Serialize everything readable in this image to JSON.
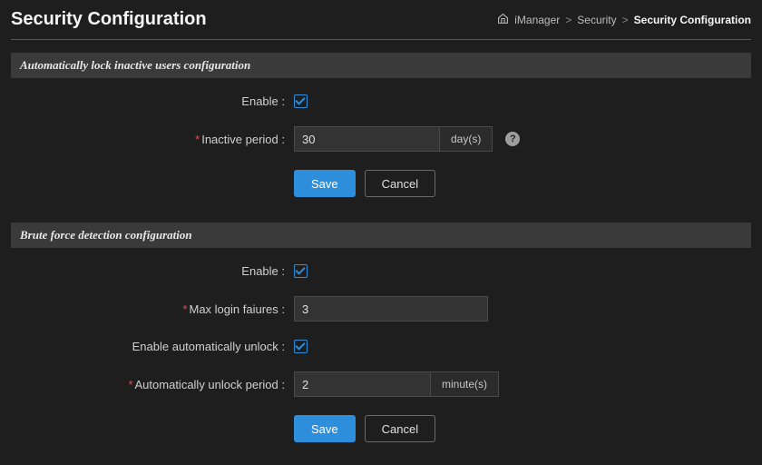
{
  "header": {
    "title": "Security Configuration"
  },
  "breadcrumb": {
    "root": "iManager",
    "level1": "Security",
    "current": "Security Configuration"
  },
  "section1": {
    "title": "Automatically lock inactive users configuration",
    "enable_label": "Enable :",
    "enable_checked": true,
    "inactive_period_label": "Inactive period :",
    "inactive_period_value": "30",
    "inactive_period_unit": "day(s)",
    "save_label": "Save",
    "cancel_label": "Cancel"
  },
  "section2": {
    "title": "Brute force detection configuration",
    "enable_label": "Enable :",
    "enable_checked": true,
    "max_failures_label": "Max login faiures :",
    "max_failures_value": "3",
    "auto_unlock_label": "Enable automatically unlock :",
    "auto_unlock_checked": true,
    "unlock_period_label": "Automatically unlock period :",
    "unlock_period_value": "2",
    "unlock_period_unit": "minute(s)",
    "save_label": "Save",
    "cancel_label": "Cancel"
  },
  "icons": {
    "help": "?"
  }
}
